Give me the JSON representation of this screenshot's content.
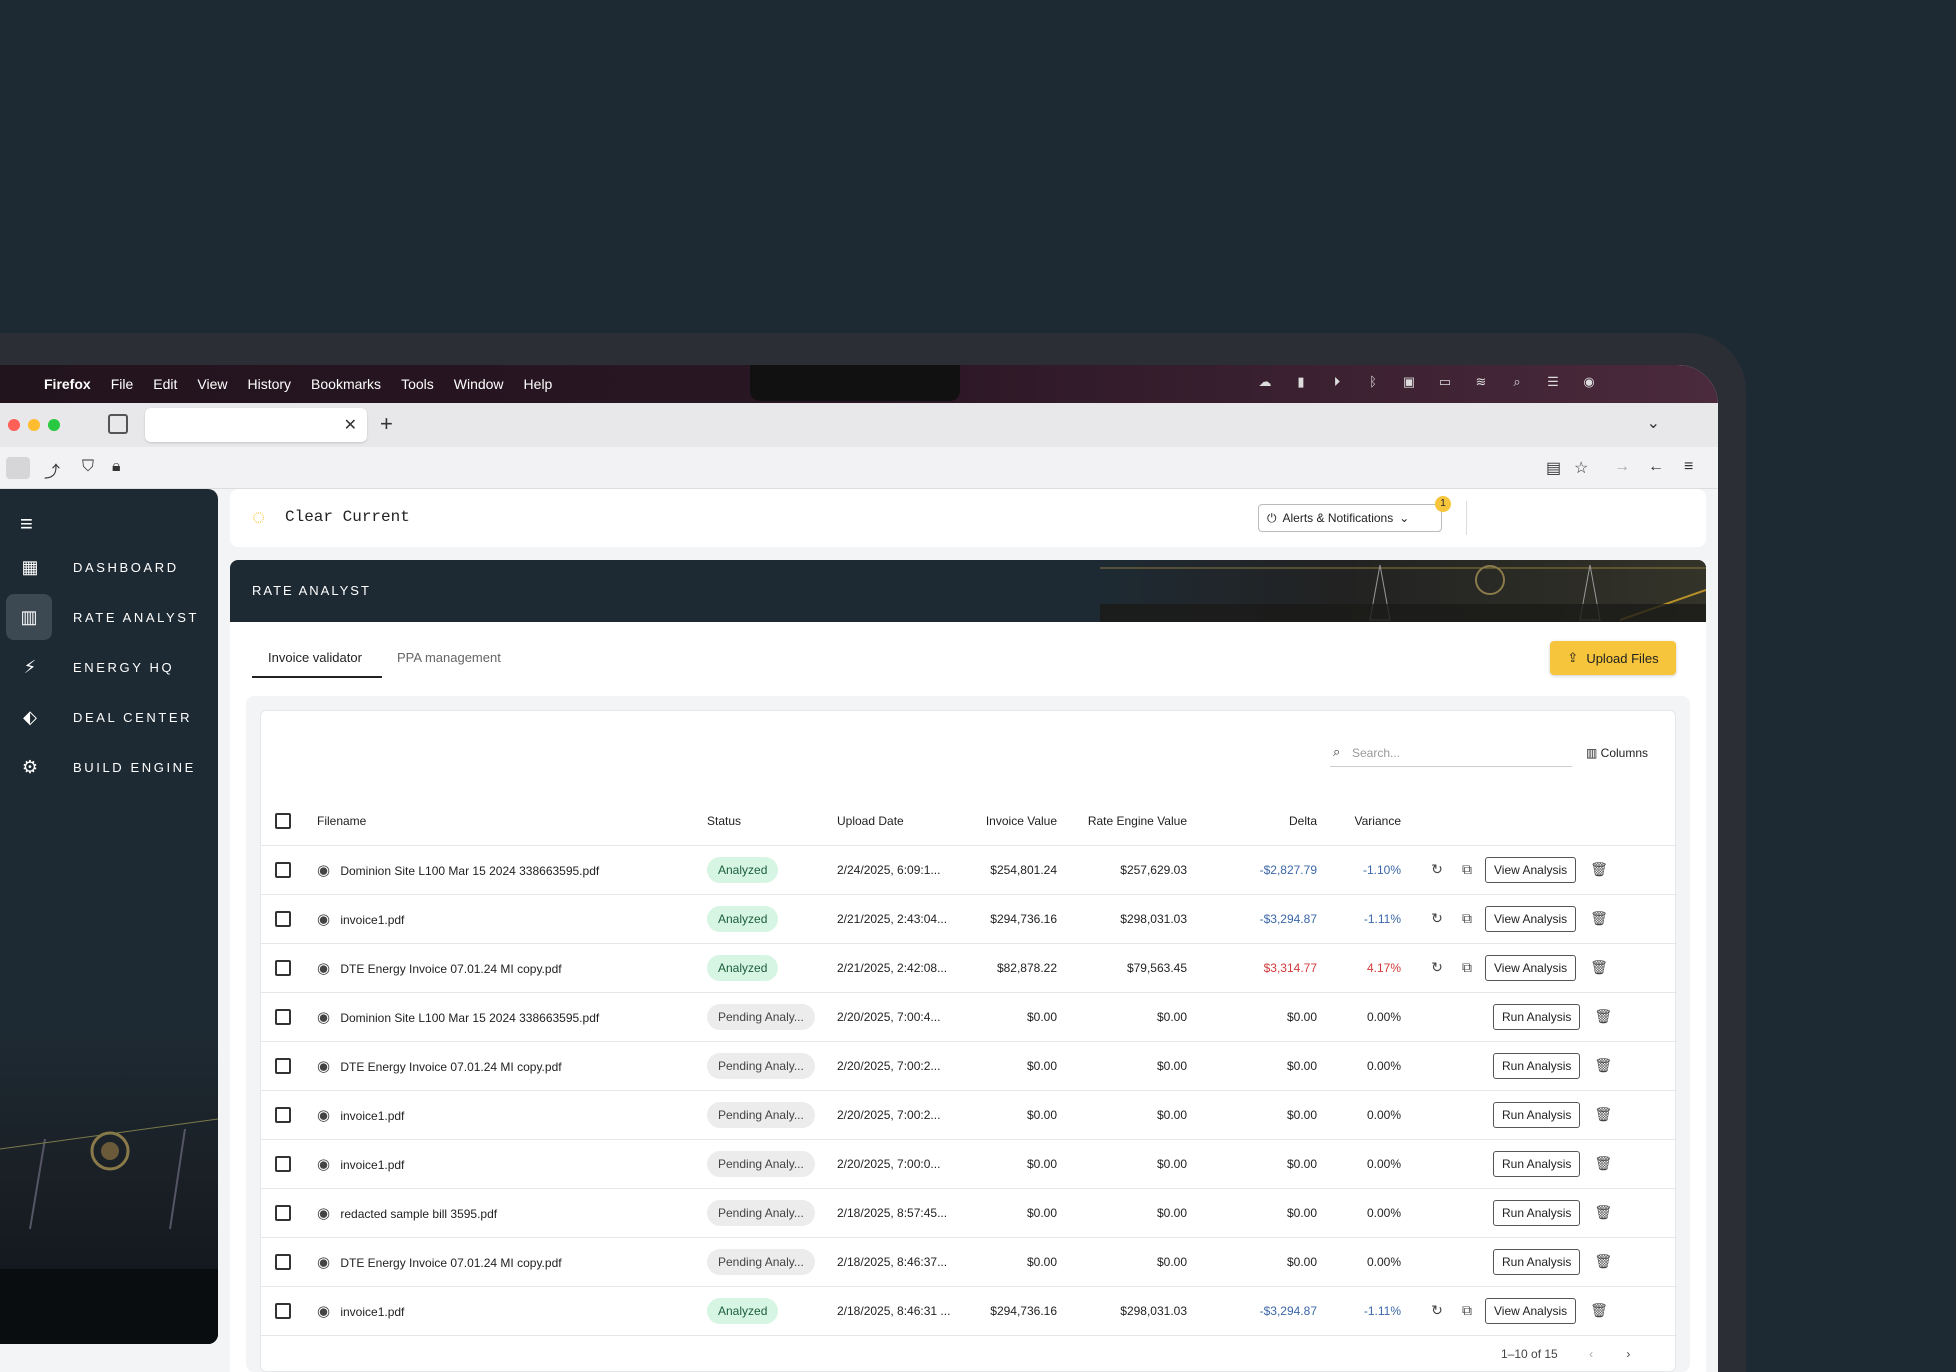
{
  "menubar": {
    "items": [
      "Firefox",
      "File",
      "Edit",
      "View",
      "History",
      "Bookmarks",
      "Tools",
      "Window",
      "Help"
    ]
  },
  "app": {
    "brand": "Clear Current",
    "alerts_label": "Alerts & Notifications",
    "alerts_count": "1",
    "banner_title": "RATE ANALYST",
    "sidebar": [
      {
        "label": "DASHBOARD",
        "icon": "dashboard-icon"
      },
      {
        "label": "RATE ANALYST",
        "icon": "chart-icon",
        "active": true
      },
      {
        "label": "ENERGY HQ",
        "icon": "lightning-icon"
      },
      {
        "label": "DEAL CENTER",
        "icon": "tag-icon"
      },
      {
        "label": "BUILD ENGINE",
        "icon": "gear-icon"
      }
    ],
    "tabs": [
      "Invoice validator",
      "PPA management"
    ],
    "upload_label": "Upload Files",
    "search_placeholder": "Search...",
    "columns_label": "Columns",
    "pagination": "1–10 of 15"
  },
  "table": {
    "headers": [
      "Filename",
      "Status",
      "Upload Date",
      "Invoice Value",
      "Rate Engine Value",
      "Delta",
      "Variance"
    ],
    "rows": [
      {
        "file": "Dominion Site L100 Mar 15 2024 338663595.pdf",
        "status": "Analyzed",
        "date": "2/24/2025, 6:09:1...",
        "invoice": "$254,801.24",
        "engine": "$257,629.03",
        "delta": "-$2,827.79",
        "variance": "-1.10%",
        "tone": "neg",
        "action": "View Analysis"
      },
      {
        "file": "invoice1.pdf",
        "status": "Analyzed",
        "date": "2/21/2025, 2:43:04...",
        "invoice": "$294,736.16",
        "engine": "$298,031.03",
        "delta": "-$3,294.87",
        "variance": "-1.11%",
        "tone": "neg",
        "action": "View Analysis"
      },
      {
        "file": "DTE Energy Invoice 07.01.24 MI copy.pdf",
        "status": "Analyzed",
        "date": "2/21/2025, 2:42:08...",
        "invoice": "$82,878.22",
        "engine": "$79,563.45",
        "delta": "$3,314.77",
        "variance": "4.17%",
        "tone": "pos",
        "action": "View Analysis"
      },
      {
        "file": "Dominion Site L100 Mar 15 2024 338663595.pdf",
        "status": "Pending Analy...",
        "date": "2/20/2025, 7:00:4...",
        "invoice": "$0.00",
        "engine": "$0.00",
        "delta": "$0.00",
        "variance": "0.00%",
        "tone": "",
        "action": "Run Analysis"
      },
      {
        "file": "DTE Energy Invoice 07.01.24 MI copy.pdf",
        "status": "Pending Analy...",
        "date": "2/20/2025, 7:00:2...",
        "invoice": "$0.00",
        "engine": "$0.00",
        "delta": "$0.00",
        "variance": "0.00%",
        "tone": "",
        "action": "Run Analysis"
      },
      {
        "file": "invoice1.pdf",
        "status": "Pending Analy...",
        "date": "2/20/2025, 7:00:2...",
        "invoice": "$0.00",
        "engine": "$0.00",
        "delta": "$0.00",
        "variance": "0.00%",
        "tone": "",
        "action": "Run Analysis"
      },
      {
        "file": "invoice1.pdf",
        "status": "Pending Analy...",
        "date": "2/20/2025, 7:00:0...",
        "invoice": "$0.00",
        "engine": "$0.00",
        "delta": "$0.00",
        "variance": "0.00%",
        "tone": "",
        "action": "Run Analysis"
      },
      {
        "file": "redacted sample bill 3595.pdf",
        "status": "Pending Analy...",
        "date": "2/18/2025, 8:57:45...",
        "invoice": "$0.00",
        "engine": "$0.00",
        "delta": "$0.00",
        "variance": "0.00%",
        "tone": "",
        "action": "Run Analysis"
      },
      {
        "file": "DTE Energy Invoice 07.01.24 MI copy.pdf",
        "status": "Pending Analy...",
        "date": "2/18/2025, 8:46:37...",
        "invoice": "$0.00",
        "engine": "$0.00",
        "delta": "$0.00",
        "variance": "0.00%",
        "tone": "",
        "action": "Run Analysis"
      },
      {
        "file": "invoice1.pdf",
        "status": "Analyzed",
        "date": "2/18/2025, 8:46:31 ...",
        "invoice": "$294,736.16",
        "engine": "$298,031.03",
        "delta": "-$3,294.87",
        "variance": "-1.11%",
        "tone": "neg",
        "action": "View Analysis"
      }
    ]
  },
  "colors": {
    "accent": "#f6c53b",
    "sidebar": "#1e2a33",
    "analyzed_bg": "#d7f5e3",
    "negative": "#3b67a8",
    "positive": "#d03a3a"
  }
}
